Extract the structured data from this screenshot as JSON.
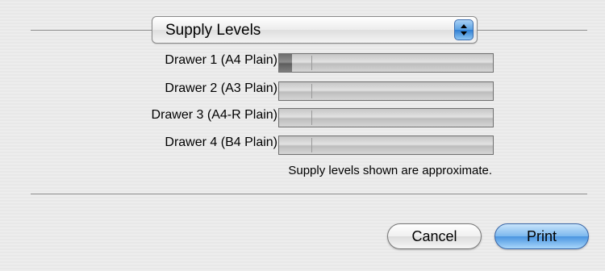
{
  "panel": {
    "selected": "Supply Levels"
  },
  "drawers": [
    {
      "label": "Drawer 1 (A4 Plain)",
      "level_fraction": 0.06
    },
    {
      "label": "Drawer 2 (A3 Plain)",
      "level_fraction": 0
    },
    {
      "label": "Drawer 3 (A4-R Plain)",
      "level_fraction": 0
    },
    {
      "label": "Drawer 4 (B4 Plain)",
      "level_fraction": 0
    }
  ],
  "note": "Supply levels shown are approximate.",
  "buttons": {
    "cancel": "Cancel",
    "print": "Print"
  },
  "colors": {
    "accent_blue": "#5aa1e3",
    "background": "#ececec"
  },
  "icons": {
    "popup_arrows": "up-down-arrows-icon"
  }
}
